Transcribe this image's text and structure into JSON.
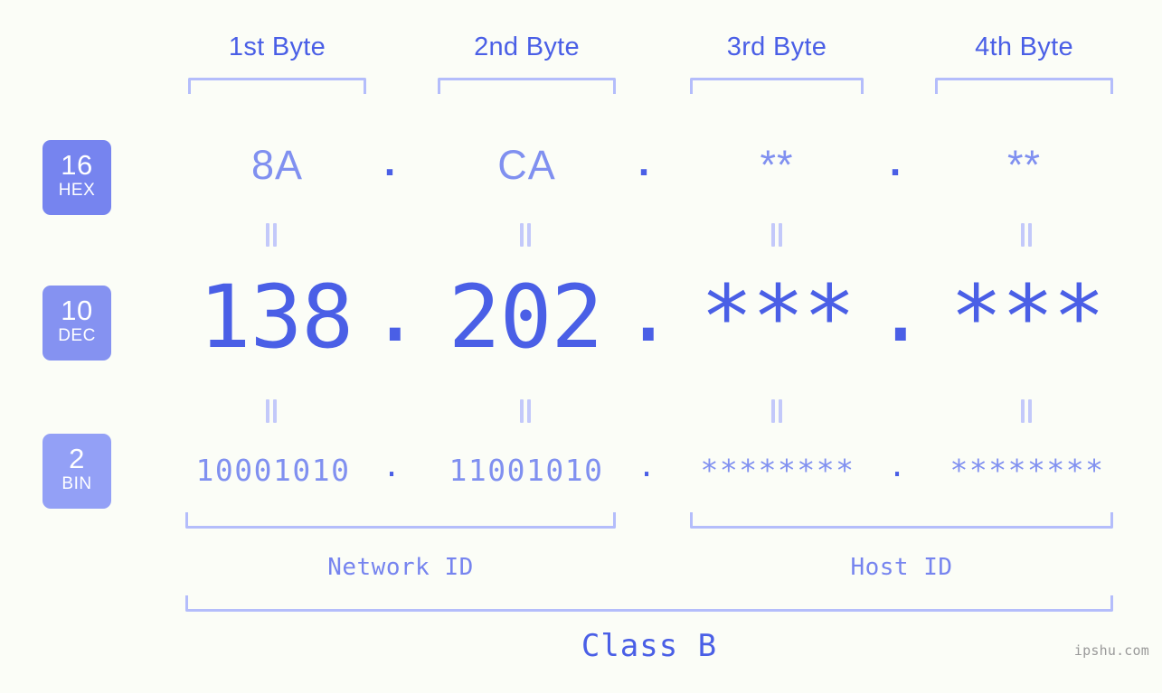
{
  "meta": {
    "watermark": "ipshu.com",
    "bg_color": "#fbfdf7",
    "accent_strong": "#4a5fe6",
    "accent_light": "#8090f0",
    "bracket_color": "#b4bdfb"
  },
  "byte_headers": [
    {
      "label": "1st Byte"
    },
    {
      "label": "2nd Byte"
    },
    {
      "label": "3rd Byte"
    },
    {
      "label": "4th Byte"
    }
  ],
  "bases": [
    {
      "number": "16",
      "name": "HEX",
      "color": "#7684ef"
    },
    {
      "number": "10",
      "name": "DEC",
      "color": "#8592f1"
    },
    {
      "number": "2",
      "name": "BIN",
      "color": "#93a0f6"
    }
  ],
  "rows": {
    "hex": {
      "base_number": "16",
      "base_name": "HEX",
      "values": [
        "8A",
        "CA",
        "**",
        "**"
      ],
      "separator": "."
    },
    "dec": {
      "base_number": "10",
      "base_name": "DEC",
      "values": [
        "138",
        "202",
        "***",
        "***"
      ],
      "separator": "."
    },
    "bin": {
      "base_number": "2",
      "base_name": "BIN",
      "values": [
        "10001010",
        "11001010",
        "********",
        "********"
      ],
      "separator": "."
    }
  },
  "sections": {
    "network_id": "Network ID",
    "host_id": "Host ID",
    "class": "Class B"
  },
  "equal_marks": {
    "glyph": "="
  }
}
